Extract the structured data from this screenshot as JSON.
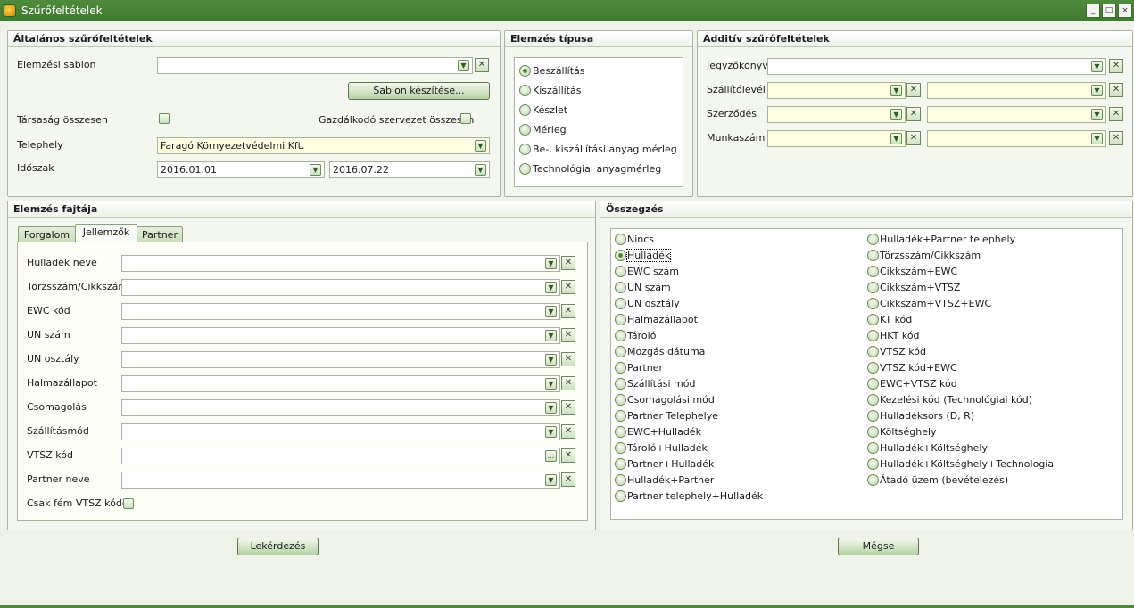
{
  "window": {
    "title": "Szűrőfeltételek",
    "buttons": [
      "_",
      "□",
      "×"
    ]
  },
  "general": {
    "header": "Általános szűrőfeltételek",
    "template_label": "Elemzési sablon",
    "template_value": "",
    "make_template_button": "Sablon készítése...",
    "company_total_label": "Társaság összesen",
    "org_total_label": "Gazdálkodó szervezet összesen",
    "site_label": "Telephely",
    "site_value": "Faragó Környezetvédelmi Kft.",
    "period_label": "Időszak",
    "date_from": "2016.01.01",
    "date_to": "2016.07.22"
  },
  "analysis_type": {
    "header": "Elemzés típusa",
    "options": [
      "Beszállítás",
      "Kiszállítás",
      "Készlet",
      "Mérleg",
      "Be-, kiszállítási anyag mérleg",
      "Technológiai anyagmérleg"
    ],
    "selected": "Beszállítás"
  },
  "additive": {
    "header": "Additív szűrőfeltételek",
    "labels": [
      "Jegyzőkönyv",
      "Szállítólevél",
      "Szerződés",
      "Munkaszám"
    ]
  },
  "kind": {
    "header": "Elemzés fajtája",
    "tabs": [
      "Forgalom",
      "Jellemzők",
      "Partner"
    ],
    "active_tab": "Jellemzők",
    "fields": [
      "Hulladék neve",
      "Törzsszám/Cikkszám",
      "EWC kód",
      "UN szám",
      "UN osztály",
      "Halmazállapot",
      "Csomagolás",
      "Szállításmód",
      "VTSZ kód",
      "Partner neve"
    ],
    "metal_only_label": "Csak fém VTSZ kódok"
  },
  "summary": {
    "header": "Összegzés",
    "col1": [
      "Nincs",
      "Hulladék",
      "EWC szám",
      "UN szám",
      "UN osztály",
      "Halmazállapot",
      "Tároló",
      "Mozgás dátuma",
      "Partner",
      "Szállítási mód",
      "Csomagolási mód",
      "Partner Telephelye",
      "EWC+Hulladék",
      "Tároló+Hulladék",
      "Partner+Hulladék",
      "Hulladék+Partner",
      "Partner telephely+Hulladék"
    ],
    "col2": [
      "Hulladék+Partner telephely",
      "Törzsszám/Cikkszám",
      "Cikkszám+EWC",
      "Cikkszám+VTSZ",
      "Cikkszám+VTSZ+EWC",
      "KT kód",
      "HKT kód",
      "VTSZ kód",
      "VTSZ kód+EWC",
      "EWC+VTSZ kód",
      "Kezelési kód (Technológiai kód)",
      "Hulladéksors (D, R)",
      "Költséghely",
      "Hulladék+Költséghely",
      "Hulladék+Költséghely+Technologia",
      "Átadó üzem (bevételezés)"
    ],
    "selected": "Hulladék"
  },
  "footer": {
    "query_button": "Lekérdezés",
    "cancel_button": "Mégse"
  }
}
